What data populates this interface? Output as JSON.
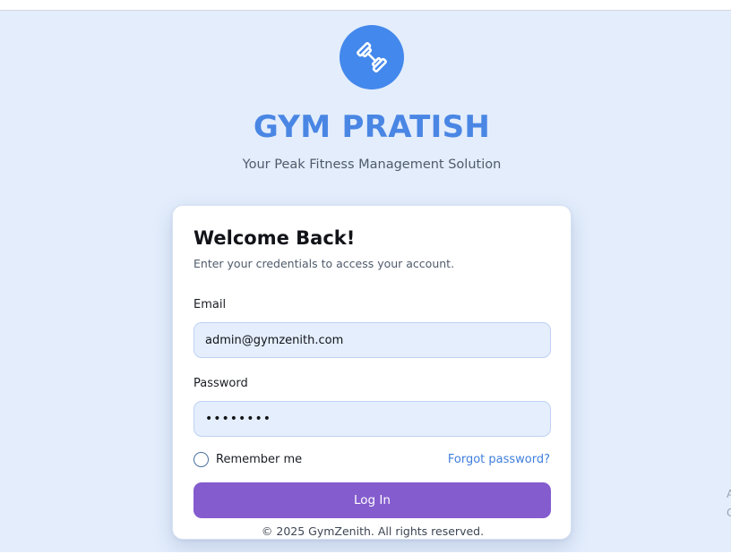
{
  "brand": {
    "name": "GYM PRATISH",
    "tagline": "Your Peak Fitness Management Solution",
    "logo_icon": "dumbbell-icon",
    "accent_color": "#4388ec"
  },
  "login": {
    "title": "Welcome Back!",
    "subtitle": "Enter your credentials to access your account.",
    "email_label": "Email",
    "email_value": "admin@gymzenith.com",
    "password_label": "Password",
    "password_value": "••••••••",
    "remember_label": "Remember me",
    "forgot_label": "Forgot password?",
    "button_label": "Log In",
    "button_color": "#845cce"
  },
  "footer": {
    "text": "© 2025 GymZenith. All rights reserved."
  },
  "edge_clip": {
    "line1": "A",
    "line2": "C"
  }
}
